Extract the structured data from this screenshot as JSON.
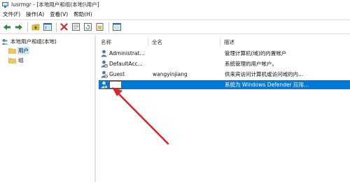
{
  "window": {
    "title": "lusrmgr - [本地用户和组(本地)\\用户]"
  },
  "menu": {
    "items": [
      "文件(F)",
      "操作(A)",
      "查看(V)",
      "帮助(H)"
    ]
  },
  "tree": {
    "root": "本地用户和组(本地)",
    "users": "用户",
    "groups": "组"
  },
  "list": {
    "headers": {
      "name": "名称",
      "fullname": "全名",
      "description": "描述"
    },
    "rows": [
      {
        "name": "Administrat...",
        "fullname": "",
        "description": "管理计算机(域)的内置帐户"
      },
      {
        "name": "DefaultAcc...",
        "fullname": "",
        "description": "系统管理的用户帐户。"
      },
      {
        "name": "Guest",
        "fullname": "wangyinjiang",
        "description": "供来宾访问计算机或访问域的内..."
      },
      {
        "name": "",
        "fullname": "",
        "description": "系统为 Windows Defender 应用..."
      }
    ]
  },
  "colors": {
    "selection": "#0078d7",
    "arrow": "#d9262b"
  }
}
